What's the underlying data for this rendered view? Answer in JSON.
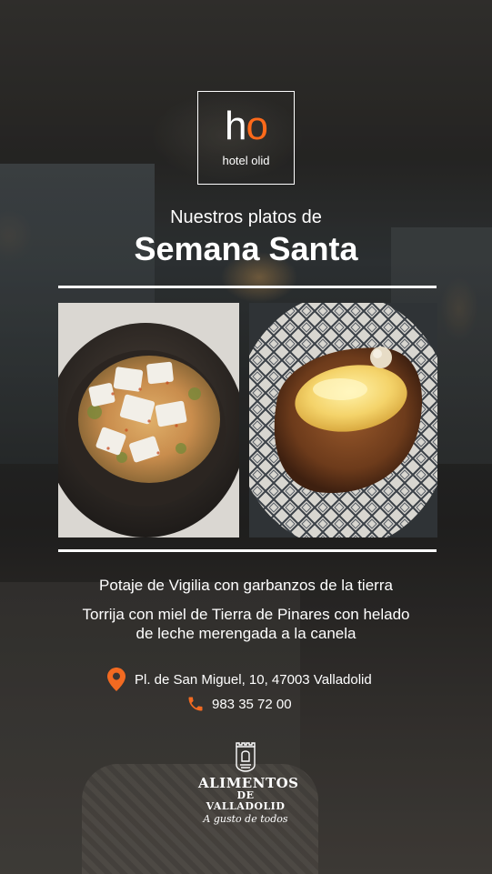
{
  "logo": {
    "mark_h": "h",
    "mark_o": "o",
    "name": "hotel olid",
    "accent_color": "#ff6a1a"
  },
  "heading": {
    "subtitle": "Nuestros platos de",
    "title": "Semana Santa"
  },
  "photos": [
    {
      "icon": "potaje-dish-photo"
    },
    {
      "icon": "torrija-dish-photo"
    }
  ],
  "dishes": [
    {
      "label": "Potaje de Vigilia con garbanzos de la tierra"
    },
    {
      "label": "Torrija con miel de Tierra de Pinares con helado de leche merengada a la canela"
    }
  ],
  "contact": {
    "address": "Pl. de San Miguel, 10, 47003 Valladolid",
    "address_icon": "location-pin-icon",
    "phone": "983 35 72 00",
    "phone_icon": "phone-icon",
    "icon_color": "#f26a21"
  },
  "brand": {
    "line1": "ALIMENTOS",
    "line2": "DE VALLADOLID",
    "tagline": "A gusto de todos"
  }
}
